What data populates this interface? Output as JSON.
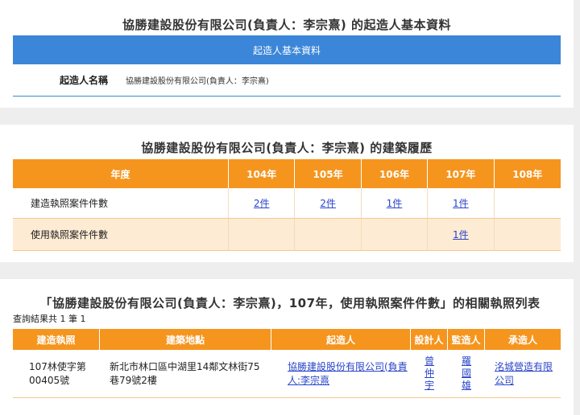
{
  "basic": {
    "title": "協勝建設股份有限公司(負責人：李宗熹) 的起造人基本資料",
    "bar_label": "起造人基本資料",
    "field_label": "起造人名稱",
    "field_value": "協勝建設股份有限公司(負責人：李宗熹)"
  },
  "history": {
    "title": "協勝建設股份有限公司(負責人：李宗熹) 的建築履歷",
    "header_label": "年度",
    "years": [
      "104年",
      "105年",
      "106年",
      "107年",
      "108年"
    ],
    "rows": [
      {
        "label": "建造執照案件件數",
        "cells": [
          "2件",
          "2件",
          "1件",
          "1件",
          ""
        ]
      },
      {
        "label": "使用執照案件件數",
        "cells": [
          "",
          "",
          "",
          "1件",
          ""
        ]
      }
    ]
  },
  "results": {
    "title": "「協勝建設股份有限公司(負責人：李宗熹)，107年，使用執照案件件數」的相關執照列表",
    "count_text": "查詢結果共 1 筆 1",
    "headers": [
      "建造執照",
      "建築地點",
      "起造人",
      "設計人",
      "監造人",
      "承造人"
    ],
    "rows": [
      {
        "license": "107林使字第00405號",
        "address": "新北市林口區中湖里14鄰文林街75巷79號2樓",
        "owner": "協勝建設股份有限公司(負責人:李宗熹",
        "designer": "曾仲宇",
        "supervisor": "羅國雄",
        "contractor": "洺城營造有限公司"
      }
    ]
  },
  "colors": {
    "blue_bar": "#3b86d8",
    "orange_header": "#f5951e",
    "link": "#2a45c9",
    "row_tint": "#fdebd3"
  }
}
